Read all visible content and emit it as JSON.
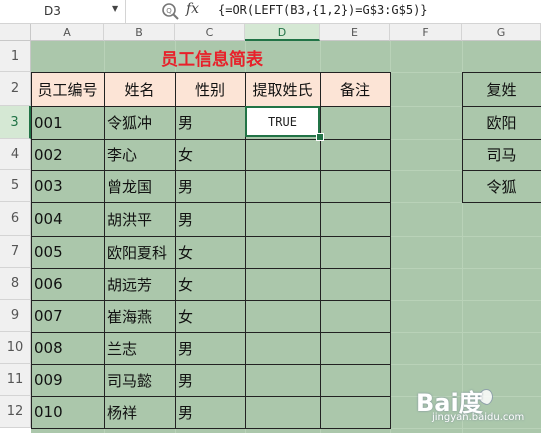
{
  "formula_bar": {
    "cell_ref": "D3",
    "fx_label": "fx",
    "formula": "{=OR(LEFT(B3,{1,2})=G$3:G$5)}"
  },
  "columns": [
    "A",
    "B",
    "C",
    "D",
    "E",
    "F",
    "G"
  ],
  "rows": [
    "1",
    "2",
    "3",
    "4",
    "5",
    "6",
    "7",
    "8",
    "9",
    "10",
    "11",
    "12"
  ],
  "sheet": {
    "title": "员工信息简表",
    "headers": [
      "员工编号",
      "姓名",
      "性别",
      "提取姓氏",
      "备注"
    ],
    "records": [
      {
        "id": "001",
        "name": "令狐冲",
        "gender": "男"
      },
      {
        "id": "002",
        "name": "李心",
        "gender": "女"
      },
      {
        "id": "003",
        "name": "曾龙国",
        "gender": "男"
      },
      {
        "id": "004",
        "name": "胡洪平",
        "gender": "男"
      },
      {
        "id": "005",
        "name": "欧阳夏科",
        "gender": "女"
      },
      {
        "id": "006",
        "name": "胡远芳",
        "gender": "女"
      },
      {
        "id": "007",
        "name": "崔海燕",
        "gender": "女"
      },
      {
        "id": "008",
        "name": "兰志",
        "gender": "男"
      },
      {
        "id": "009",
        "name": "司马懿",
        "gender": "男"
      },
      {
        "id": "010",
        "name": "杨祥",
        "gender": "男"
      }
    ],
    "active_cell_value": "TRUE",
    "compound_surnames": {
      "header": "复姓",
      "items": [
        "欧阳",
        "司马",
        "令狐"
      ]
    }
  },
  "watermark": {
    "brand": "Bai度",
    "sub": "jingyan.baidu.com"
  },
  "colors": {
    "grid_bg": "#d5ead4",
    "header_fill": "#fce4d6",
    "title_red": "#e8202a",
    "selection_green": "#217346"
  }
}
